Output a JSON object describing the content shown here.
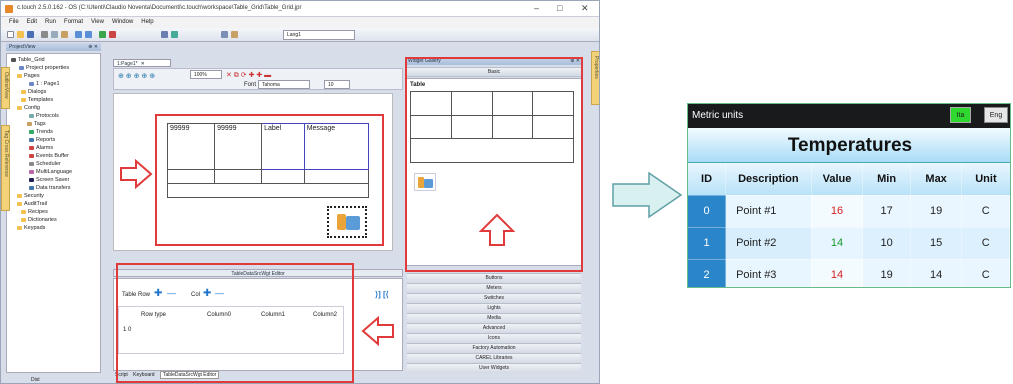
{
  "window": {
    "title": "c.touch 2.5.0.162 - OS (C:\\Utenti\\Claudio Noventa\\Documenti\\c.touch\\workspace\\Table_Grid\\Table_Grid.jpr",
    "min": "–",
    "max": "□",
    "close": "✕"
  },
  "menu": [
    "File",
    "Edit",
    "Run",
    "Format",
    "View",
    "Window",
    "Help"
  ],
  "toolbar": {
    "language": "Lang1",
    "zoom": "100%",
    "font_label": "Font",
    "font": "Tahoma",
    "font_size": "10"
  },
  "project_view": {
    "title": "ProjectView",
    "pin": "⊕ ✕",
    "items": [
      "Table_Grid",
      "Project properties",
      "Pages",
      "1 : Page1",
      "Dialogs",
      "Templates",
      "Config",
      "Protocols",
      "Tags",
      "Trends",
      "Reports",
      "Alarms",
      "Events Buffer",
      "Scheduler",
      "MultiLanguage",
      "Screen Saver",
      "Data transfers",
      "Security",
      "AuditTrail",
      "Recipes",
      "Dictionaries",
      "Keypads"
    ]
  },
  "side_tabs": {
    "left1": "OutlineView",
    "left2": "Tag Cross Reference",
    "right": "Properties"
  },
  "editor_tab": "1:Page1*",
  "grid_cells": {
    "r1c1": "99999",
    "r1c2": "99999",
    "r1c3": "Label",
    "r1c4": "Message"
  },
  "widget_gallery": {
    "title": "Widget Gallery",
    "pin": "⊕ ✕",
    "basic": "Basic",
    "table": "Table"
  },
  "categories": [
    "Buttons",
    "Meters",
    "Switches",
    "Lights",
    "Media",
    "Advanced",
    "Icons",
    "Factory Automation",
    "CAREL Libraries",
    "User Widgets"
  ],
  "editor": {
    "title": "TableDataSrcWgt Editor",
    "table_row": "Table Row",
    "col": "Col",
    "columns": [
      "Row type",
      "Column0",
      "Column1",
      "Column2"
    ],
    "row_value": "1 0",
    "nav": "⟩] [⟨"
  },
  "bottom_tabs": {
    "script": "Script",
    "keyboard": "Keyboard",
    "editor": "TableDataSrcWgt Editor"
  },
  "status": {
    "left": "Dist"
  },
  "preview": {
    "header": "Metric units",
    "btn1": "Ita",
    "btn2": "Eng",
    "title": "Temperatures",
    "columns": [
      "ID",
      "Description",
      "Value",
      "Min",
      "Max",
      "Unit"
    ],
    "rows": [
      [
        "0",
        "Point #1",
        "16",
        "17",
        "19",
        "C"
      ],
      [
        "1",
        "Point #2",
        "14",
        "10",
        "15",
        "C"
      ],
      [
        "2",
        "Point #3",
        "14",
        "19",
        "14",
        "C"
      ]
    ],
    "value_colors": [
      "#d62020",
      "#1a9a2a",
      "#d62020"
    ]
  },
  "colors": {
    "highlight": "#e03a3a",
    "arrow_fill": "#d8f0f0",
    "arrow_stroke": "#5f9fa5",
    "header_bg": "#191a1c",
    "table_bg": "#2b93d5",
    "btn_green": "#2fd82f"
  }
}
